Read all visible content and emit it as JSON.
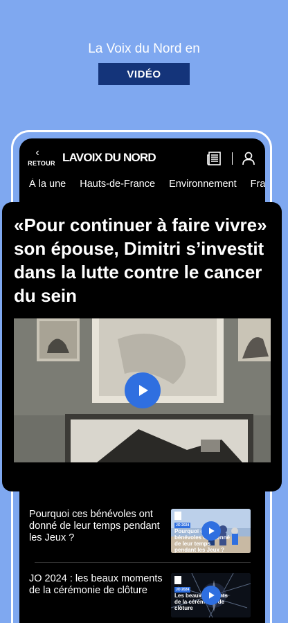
{
  "promo": {
    "title": "La Voix du Nord en",
    "badge": "VIDÉO"
  },
  "app_header": {
    "back_label": "RETOUR",
    "back_arrow": "‹",
    "brand": "LAVOIX DU NORD"
  },
  "icons": {
    "back": "chevron-left-icon",
    "edition": "newspaper-icon",
    "account": "user-icon",
    "play": "play-icon"
  },
  "nav": {
    "tabs": [
      "À la une",
      "Hauts-de-France",
      "Environnement",
      "France"
    ]
  },
  "featured": {
    "title": "«Pour continuer à faire vivre» son épouse, Dimitri s’investit dans la lutte contre le cancer du sein"
  },
  "articles": [
    {
      "title": "Pourquoi ces bénévoles ont donné de leur temps pendant les Jeux ?",
      "thumb_tag": "JO 2024",
      "thumb_caption": "Pourquoi ces bénévoles ont donné de leur temps pendant les Jeux ?"
    },
    {
      "title": "JO 2024 : les beaux moments de la cérémonie de clôture",
      "thumb_tag": "JO 2024",
      "thumb_caption": "Les beaux moments de la cérémonie de clôture"
    }
  ],
  "colors": {
    "background": "#7fa8f0",
    "badge": "#14347a",
    "accent": "#2f6fe0",
    "screen": "#000000"
  }
}
